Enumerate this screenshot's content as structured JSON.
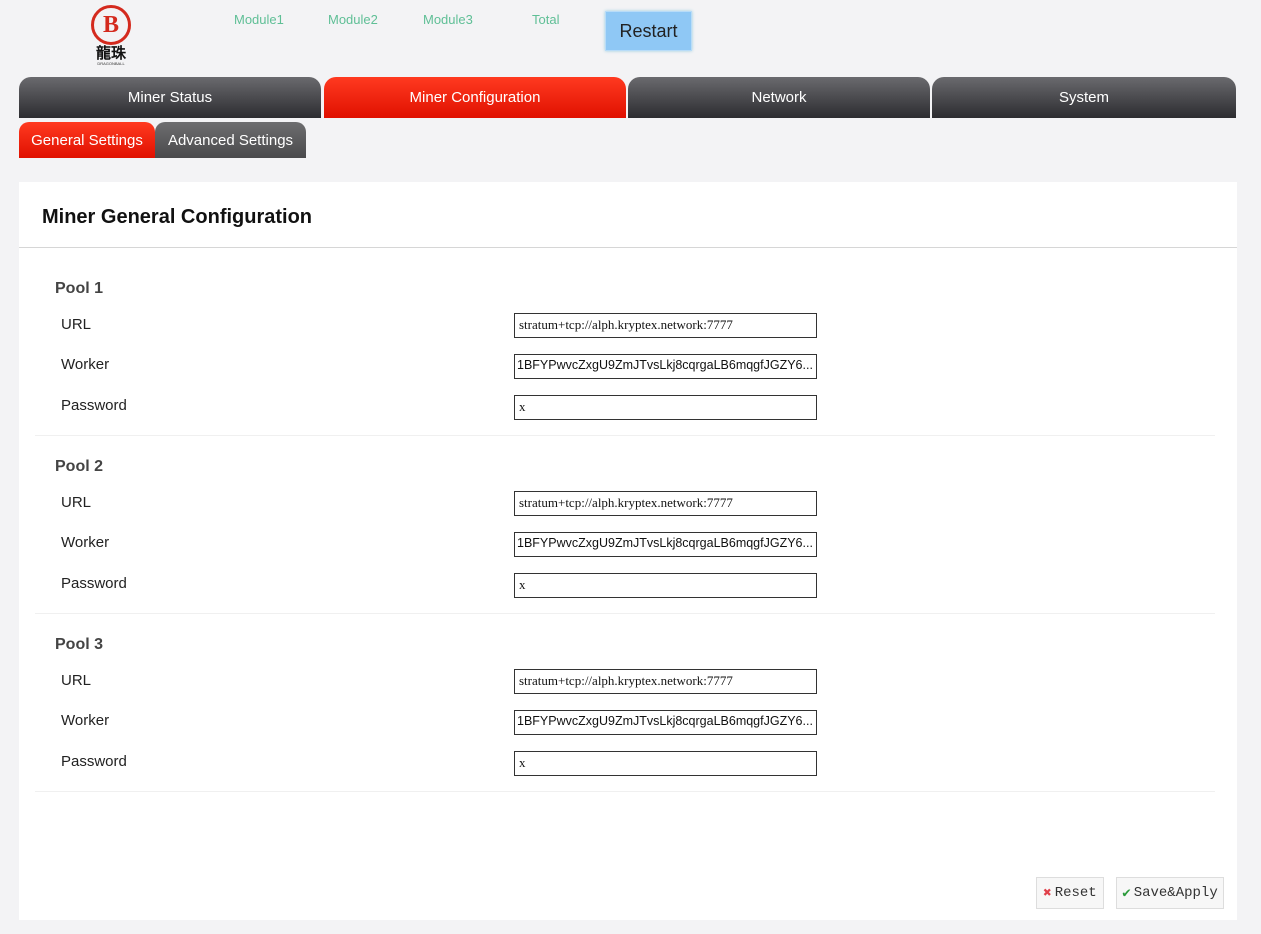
{
  "logo": {
    "mark": "B",
    "cn": "龍珠",
    "en": "DRAGONBALL"
  },
  "header": {
    "modules": [
      "Module1",
      "Module2",
      "Module3",
      "Total"
    ],
    "restart": "Restart"
  },
  "tabs": [
    "Miner Status",
    "Miner Configuration",
    "Network",
    "System"
  ],
  "subtabs": [
    "General Settings",
    "Advanced Settings"
  ],
  "panel": {
    "title": "Miner General Configuration",
    "labels": {
      "url": "URL",
      "worker": "Worker",
      "password": "Password"
    },
    "pools": [
      {
        "name": "Pool 1",
        "url": "stratum+tcp://alph.kryptex.network:7777",
        "worker": "1BFYPwvcZxgU9ZmJTvsLkj8cqrgaLB6mqgfJGZY6...",
        "password": "x"
      },
      {
        "name": "Pool 2",
        "url": "stratum+tcp://alph.kryptex.network:7777",
        "worker": "1BFYPwvcZxgU9ZmJTvsLkj8cqrgaLB6mqgfJGZY6...",
        "password": "x"
      },
      {
        "name": "Pool 3",
        "url": "stratum+tcp://alph.kryptex.network:7777",
        "worker": "1BFYPwvcZxgU9ZmJTvsLkj8cqrgaLB6mqgfJGZY6...",
        "password": "x"
      }
    ]
  },
  "buttons": {
    "reset": "Reset",
    "save": "Save&Apply"
  },
  "colors": {
    "accent": "#e81a05",
    "tab_dark": "#3a3a3e",
    "module_text": "#5fbf96",
    "restart_bg": "#8fc8f5"
  }
}
